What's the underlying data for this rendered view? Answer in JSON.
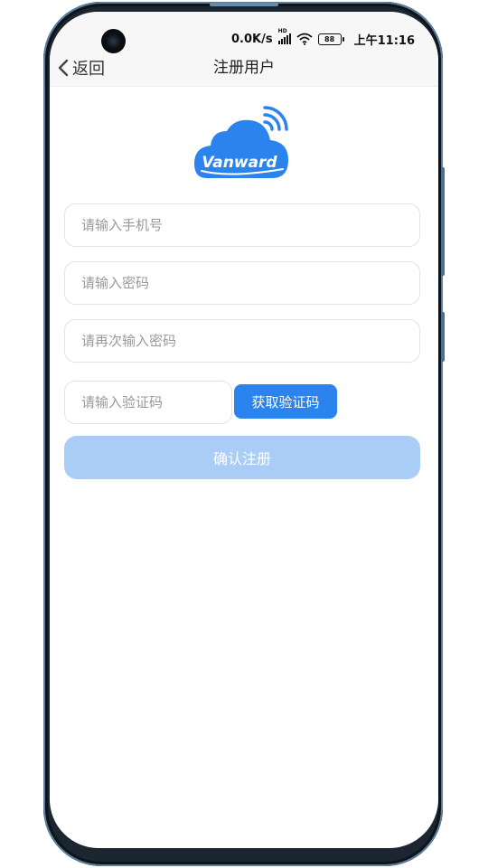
{
  "status_bar": {
    "net_speed": "0.0K/s",
    "hd_tag": "HD",
    "battery": "88",
    "time": "上午11:16"
  },
  "nav": {
    "back_label": "返回",
    "title": "注册用户"
  },
  "logo": {
    "text": "Vanward",
    "brand_color": "#2b84ee"
  },
  "form": {
    "phone_placeholder": "请输入手机号",
    "password_placeholder": "请输入密码",
    "password_confirm_placeholder": "请再次输入密码",
    "code_placeholder": "请输入验证码",
    "get_code_label": "获取验证码",
    "submit_label": "确认注册"
  },
  "colors": {
    "primary": "#2b84ee",
    "submit_disabled": "#a9cdf7",
    "placeholder": "#999999"
  }
}
